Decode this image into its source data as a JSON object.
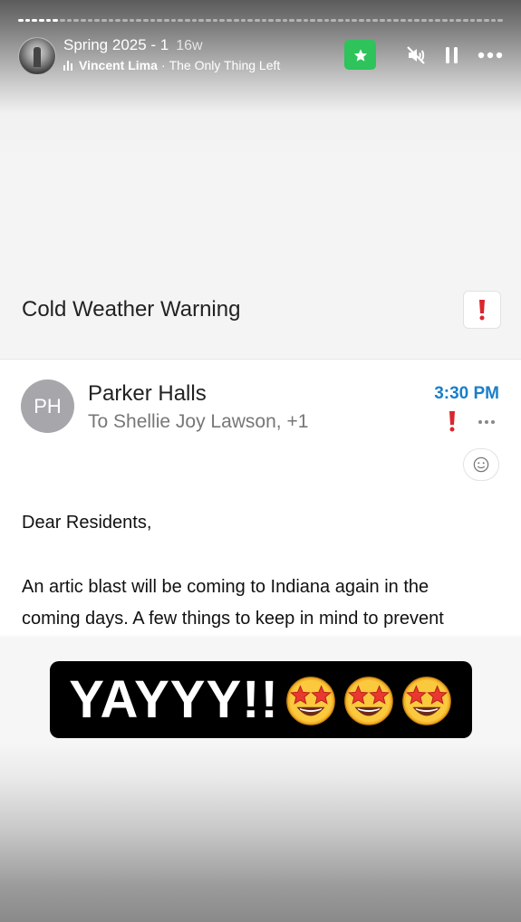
{
  "story": {
    "title": "Spring 2025 - 1",
    "age": "16w",
    "music": {
      "artist": "Vincent Lima",
      "separator": "·",
      "song": "The Only Thing Left"
    },
    "controls": {
      "star_icon": "star-icon",
      "mute_icon": "speaker-muted-icon",
      "pause_icon": "pause-icon",
      "more_icon": "more-horizontal-icon",
      "accent": "#2ec35b"
    },
    "sticker_text": "YAYYY!!"
  },
  "email": {
    "subject": "Cold Weather Warning",
    "sender_initials": "PH",
    "sender_name": "Parker Halls",
    "recipients": "To Shellie Joy Lawson, +1",
    "time": "3:30 PM",
    "time_color": "#1a7fc9",
    "flag_color": "#d9262e",
    "body": {
      "line1": "Dear Residents,",
      "line2": "An artic blast will be coming to Indiana again in the",
      "line3": "coming days. A few things to keep in mind to prevent"
    }
  }
}
